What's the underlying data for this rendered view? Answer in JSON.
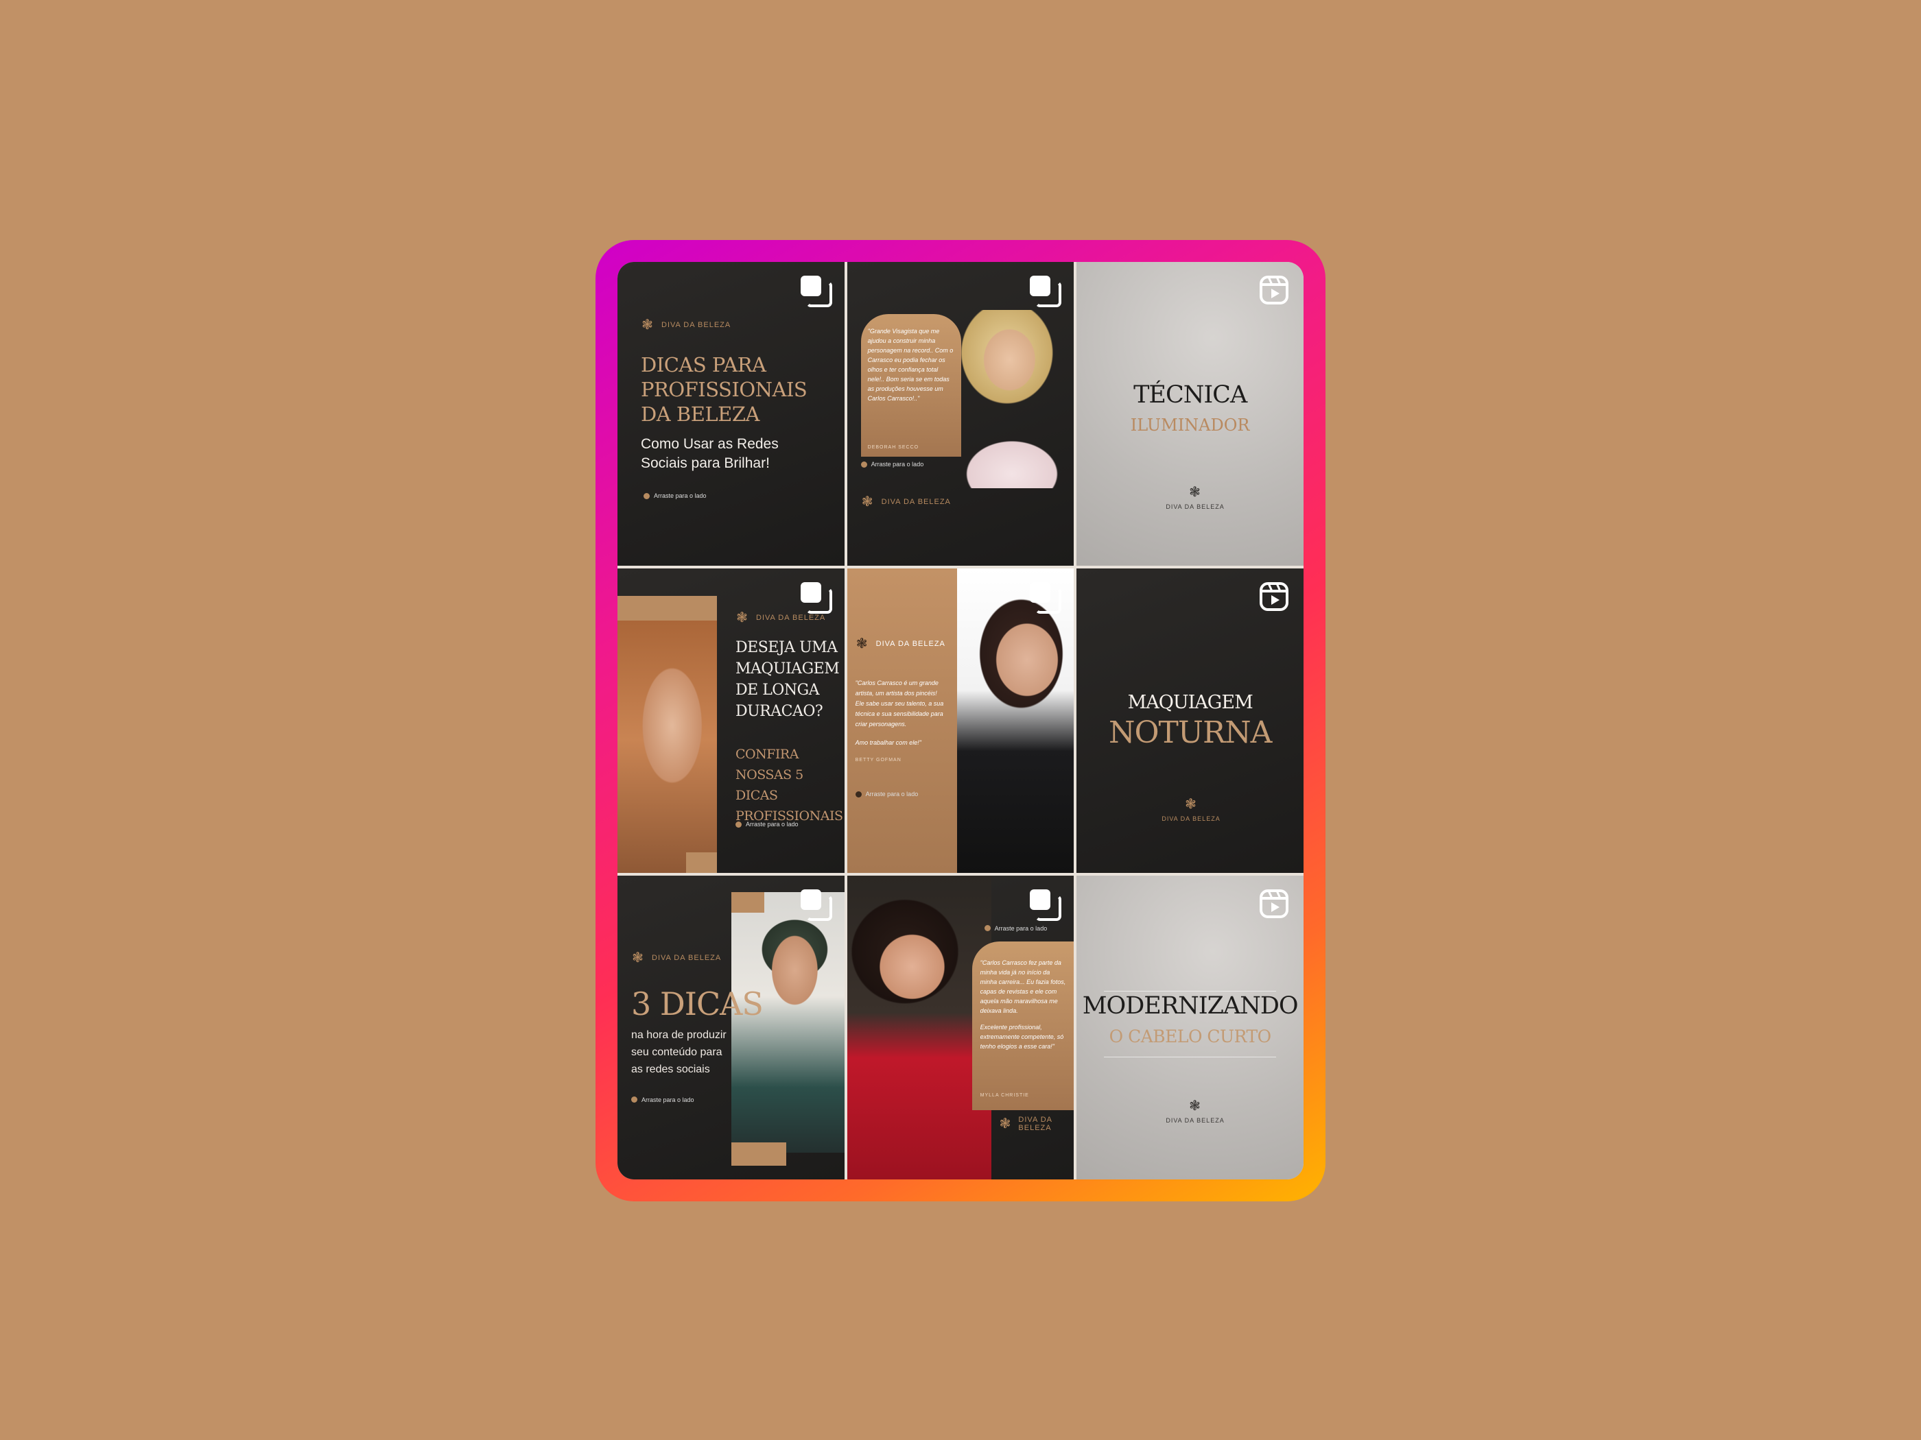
{
  "brand": {
    "logo_text": "DIVA DA BELEZA",
    "logo_text_alt": "DIVA DA BELEZA",
    "swipe_label": "Arraste para o lado"
  },
  "icons": {
    "carousel": "carousel-icon",
    "reel": "reel-icon",
    "logo_mark": "flower-ornament-icon"
  },
  "colors": {
    "background": "#c19166",
    "gold": "#c9a07a",
    "dark": "#1f1e1d",
    "ring_start": "#cf00c8",
    "ring_end": "#ffb300"
  },
  "posts": {
    "p1": {
      "title_line1": "DICAS PARA",
      "title_line2": "PROFISSIONAIS",
      "title_line3": "DA BELEZA",
      "subtitle_line1": "Como Usar as Redes",
      "subtitle_line2": "Sociais para Brilhar!"
    },
    "p2": {
      "quote": "\"Grande Visagista que me ajudou a construir minha personagem na record.. Com o Carrasco eu podia fechar os olhos e ter confiança total nele!.. Bom seria se em todas as produções houvesse um Carlos Carrasco!..\"",
      "author": "DEBORAH SECCO"
    },
    "p3": {
      "title": "TÉCNICA",
      "subtitle": "ILUMINADOR"
    },
    "p4": {
      "q1": "DESEJA UMA",
      "q2": "MAQUIAGEM",
      "q3": "DE LONGA",
      "q4": "DURACAO?",
      "a1": "CONFIRA",
      "a2": "NOSSAS 5 DICAS",
      "a3": "PROFISSIONAIS!"
    },
    "p5": {
      "quote": "\"Carlos Carrasco é um grande artista, um artista dos pincéis! Ele sabe usar seu talento, a sua técnica e sua sensibilidade para criar personagens.",
      "quote2": "Amo trabalhar com ele!\"",
      "author": "BETTY GOFMAN"
    },
    "p6": {
      "title1": "MAQUIAGEM",
      "title2": "NOTURNA"
    },
    "p7": {
      "big": "3 DICAS",
      "sub1": "na hora de produzir",
      "sub2": "seu conteúdo para",
      "sub3": "as redes sociais"
    },
    "p8": {
      "quote": "\"Carlos Carrasco fez parte da minha vida já no início da minha carreira... Eu fazia fotos, capas de revistas e ele com aquela mão maravilhosa me deixava linda.",
      "quote2": "Excelente profissional, extremamente competente, só tenho elogios a esse cara!\"",
      "author": "MYLLA CHRISTIE"
    },
    "p9": {
      "title": "MODERNIZANDO",
      "subtitle": "O CABELO CURTO"
    }
  }
}
